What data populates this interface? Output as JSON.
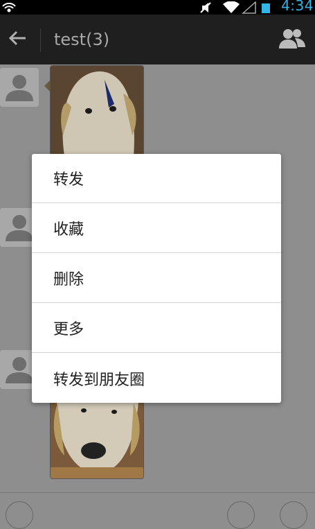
{
  "status_bar": {
    "time": "4:34",
    "icons": [
      "wifi-hotspot-icon",
      "mute-icon",
      "wifi-icon",
      "signal-icon",
      "battery-icon"
    ]
  },
  "action_bar": {
    "title": "test(3)",
    "back_icon": "arrow-left-icon",
    "contacts_icon": "group-icon"
  },
  "context_menu": {
    "items": [
      {
        "label": "转发"
      },
      {
        "label": "收藏"
      },
      {
        "label": "删除"
      },
      {
        "label": "更多"
      },
      {
        "label": "转发到朋友圈"
      }
    ]
  },
  "colors": {
    "status_time": "#33b5e5",
    "action_bar_bg": "#1f1f1f",
    "dim_bg": "#8e8e8e",
    "menu_bg": "#ffffff"
  }
}
